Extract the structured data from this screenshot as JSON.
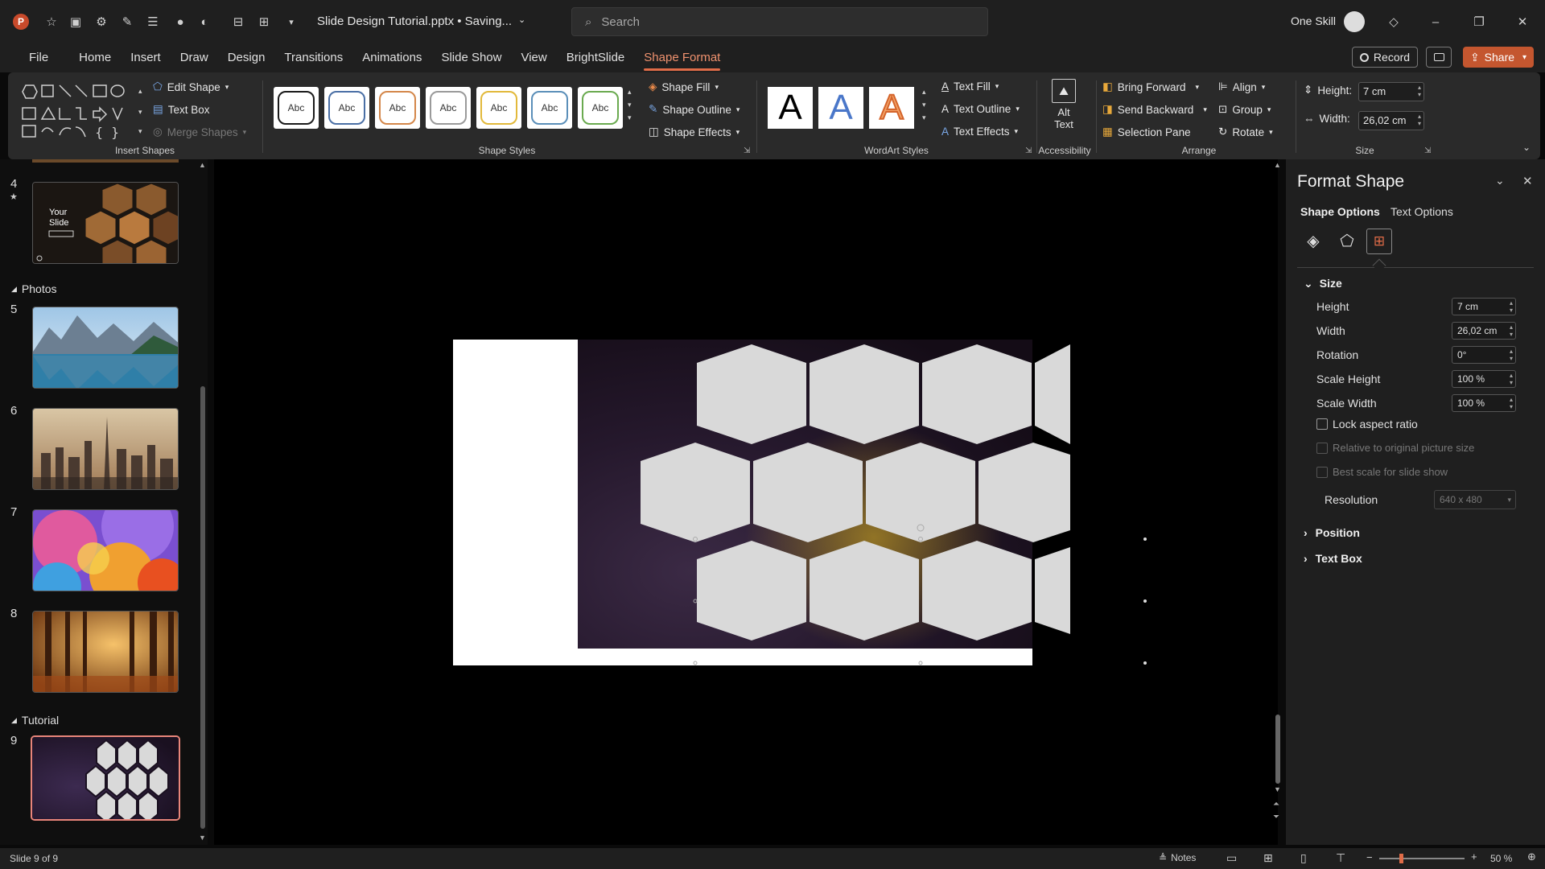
{
  "window": {
    "doc_title": "Slide Design Tutorial.pptx • Saving...",
    "user": "One Skill",
    "search_placeholder": "Search",
    "record_label": "Record",
    "share_label": "Share"
  },
  "menu": [
    "File",
    "Home",
    "Insert",
    "Draw",
    "Design",
    "Transitions",
    "Animations",
    "Slide Show",
    "View",
    "BrightSlide",
    "Shape Format"
  ],
  "ribbon": {
    "insert_shapes": {
      "label": "Insert Shapes",
      "edit_shape": "Edit Shape",
      "text_box": "Text Box",
      "merge_shapes": "Merge Shapes"
    },
    "shape_styles": {
      "label": "Shape Styles",
      "sample": "Abc",
      "shape_fill": "Shape Fill",
      "shape_outline": "Shape Outline",
      "shape_effects": "Shape Effects",
      "swatches": [
        "#1a1a1a",
        "#4a6fa5",
        "#d4874a",
        "#9a9a9a",
        "#e2b93b",
        "#5b8fb9",
        "#6aaa4f"
      ]
    },
    "wordart": {
      "label": "WordArt Styles",
      "letter": "A",
      "text_fill": "Text Fill",
      "text_outline": "Text Outline",
      "text_effects": "Text Effects"
    },
    "accessibility": {
      "label": "Accessibility",
      "alt_text_line1": "Alt",
      "alt_text_line2": "Text"
    },
    "arrange": {
      "label": "Arrange",
      "bring_forward": "Bring Forward",
      "send_backward": "Send Backward",
      "selection_pane": "Selection Pane",
      "align": "Align",
      "group": "Group",
      "rotate": "Rotate"
    },
    "size": {
      "label": "Size",
      "height_label": "Height:",
      "height_value": "7 cm",
      "width_label": "Width:",
      "width_value": "26,02 cm"
    }
  },
  "slides": {
    "sections": {
      "photos": "Photos",
      "tutorial": "Tutorial"
    },
    "numbers": [
      "4",
      "5",
      "6",
      "7",
      "8",
      "9"
    ],
    "thumb4_title_line1": "Your",
    "thumb4_title_line2": "Slide"
  },
  "format_pane": {
    "title": "Format Shape",
    "tab_shape": "Shape Options",
    "tab_text": "Text Options",
    "size_header": "Size",
    "rows": [
      {
        "label": "Height",
        "value": "7 cm"
      },
      {
        "label": "Width",
        "value": "26,02 cm"
      },
      {
        "label": "Rotation",
        "value": "0°"
      },
      {
        "label": "Scale Height",
        "value": "100 %"
      },
      {
        "label": "Scale Width",
        "value": "100 %"
      }
    ],
    "lock_aspect": "Lock aspect ratio",
    "relative_original": "Relative to original picture size",
    "best_scale": "Best scale for slide show",
    "resolution_label": "Resolution",
    "resolution_value": "640 x 480",
    "position_header": "Position",
    "textbox_header": "Text Box"
  },
  "status": {
    "slide_info": "Slide 9 of 9",
    "notes": "Notes",
    "zoom": "50 %",
    "zoom_level": 50
  },
  "colors": {
    "accent": "#e06c48",
    "hexagon": "#d9d9d9",
    "share_bg": "#c4562f"
  }
}
